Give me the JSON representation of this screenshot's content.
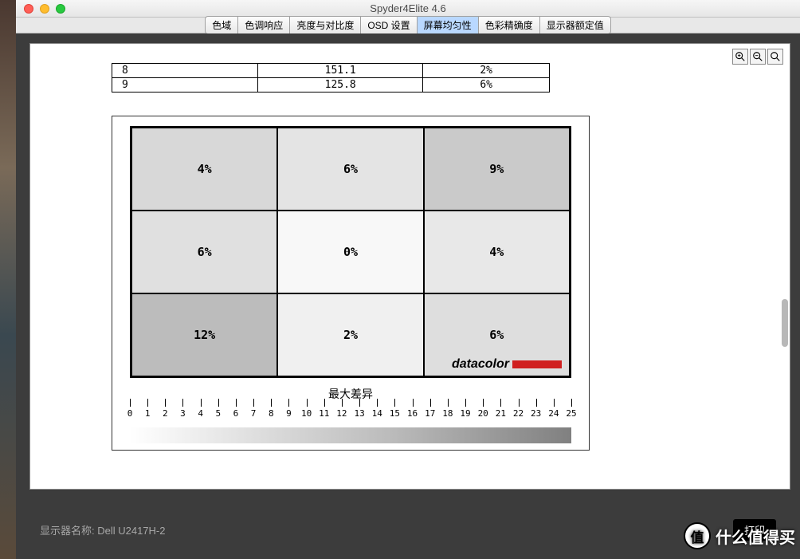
{
  "window": {
    "title": "Spyder4Elite 4.6"
  },
  "tabs": [
    {
      "label": "色域",
      "active": false
    },
    {
      "label": "色调响应",
      "active": false
    },
    {
      "label": "亮度与对比度",
      "active": false
    },
    {
      "label": "OSD 设置",
      "active": false
    },
    {
      "label": "屏幕均匀性",
      "active": true
    },
    {
      "label": "色彩精确度",
      "active": false
    },
    {
      "label": "显示器额定值",
      "active": false
    }
  ],
  "table_rows": [
    {
      "idx": "8",
      "val": "151.1",
      "pct": "2%"
    },
    {
      "idx": "9",
      "val": "125.8",
      "pct": "6%"
    }
  ],
  "chart_data": {
    "type": "heatmap",
    "title": "最大差异",
    "grid": [
      [
        "4%",
        "6%",
        "9%"
      ],
      [
        "6%",
        "0%",
        "4%"
      ],
      [
        "12%",
        "2%",
        "6%"
      ]
    ],
    "legend_range": [
      0,
      25
    ],
    "legend_ticks": [
      0,
      1,
      2,
      3,
      4,
      5,
      6,
      7,
      8,
      9,
      10,
      11,
      12,
      13,
      14,
      15,
      16,
      17,
      18,
      19,
      20,
      21,
      22,
      23,
      24,
      25
    ],
    "brand": "datacolor"
  },
  "footer": {
    "display_label": "显示器名称: Dell U2417H-2",
    "print": "打印"
  },
  "watermark": {
    "circle": "值",
    "text": "什么值得买"
  }
}
